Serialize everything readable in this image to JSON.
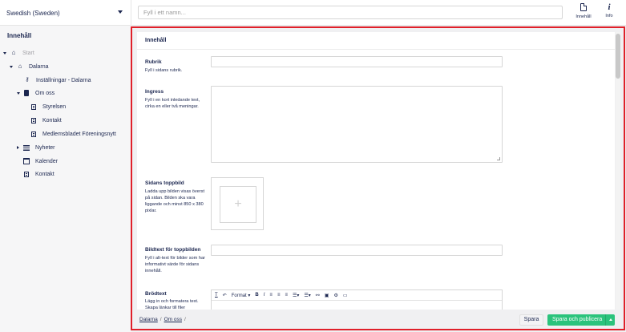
{
  "header": {
    "language": "Swedish (Sweden)",
    "name_placeholder": "Fyll i ett namn...",
    "apps": [
      {
        "label": "Innehåll",
        "icon": "document-icon"
      },
      {
        "label": "Info",
        "icon": "info-icon"
      }
    ]
  },
  "sidebar": {
    "title": "Innehåll",
    "items": [
      {
        "label": "Start",
        "icon": "home-icon"
      },
      {
        "label": "Dalarna",
        "icon": "home-group-icon"
      },
      {
        "label": "Inställningar - Dalarna",
        "icon": "settings-key-icon"
      },
      {
        "label": "Om oss",
        "icon": "book-icon"
      },
      {
        "label": "Styrelsen",
        "icon": "document-icon"
      },
      {
        "label": "Kontakt",
        "icon": "document-icon"
      },
      {
        "label": "Medlemsbladet Föreningsnytt",
        "icon": "document-icon"
      },
      {
        "label": "Nyheter",
        "icon": "list-icon"
      },
      {
        "label": "Kalender",
        "icon": "calendar-icon"
      },
      {
        "label": "Kontakt",
        "icon": "document-icon"
      }
    ]
  },
  "editor": {
    "tab_title": "Innehåll",
    "fields": {
      "rubrik": {
        "label": "Rubrik",
        "desc": "Fyll i sidans rubrik."
      },
      "ingress": {
        "label": "Ingress",
        "desc": "Fyll i en kort inledande text, cirka en eller två meningar."
      },
      "toppbild": {
        "label": "Sidans toppbild",
        "desc": "Ladda upp bilden visas överst på sidan. Bilden ska vara liggande och minst 850 x 380 pixlar."
      },
      "bildtext": {
        "label": "Bildtext för toppbilden",
        "desc": "Fyll i alt-text för bilder som har informativt värde för sidans innehåll."
      },
      "brodtext": {
        "label": "Brödtext",
        "desc": "Lägg in och formatera text. Skapa länkar till filer"
      }
    },
    "rte_format": "Format"
  },
  "footer": {
    "breadcrumb": [
      "Dalarna",
      "Om oss"
    ],
    "save_label": "Spara",
    "publish_label": "Spara och publicera"
  },
  "colors": {
    "accent_green": "#2bc37c",
    "text_navy": "#1b264f",
    "highlight_red": "#e0202a"
  }
}
